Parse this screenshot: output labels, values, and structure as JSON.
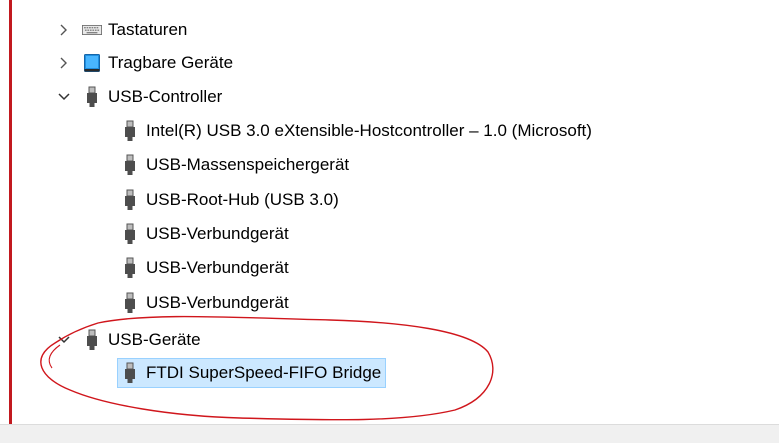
{
  "tree": {
    "tastaturen": {
      "label": "Tastaturen",
      "state": "collapsed"
    },
    "tragbare": {
      "label": "Tragbare Geräte",
      "state": "collapsed"
    },
    "usb_controller": {
      "label": "USB-Controller",
      "state": "expanded",
      "children": [
        "Intel(R) USB 3.0 eXtensible-Hostcontroller – 1.0 (Microsoft)",
        "USB-Massenspeichergerät",
        "USB-Root-Hub (USB 3.0)",
        "USB-Verbundgerät",
        "USB-Verbundgerät",
        "USB-Verbundgerät"
      ]
    },
    "usb_geraete": {
      "label": "USB-Geräte",
      "state": "expanded",
      "children": [
        "FTDI SuperSpeed-FIFO Bridge"
      ],
      "selected_child": "FTDI SuperSpeed-FIFO Bridge"
    }
  },
  "icons": {
    "keyboard": "keyboard-icon",
    "portable": "portable-device-icon",
    "usb": "usb-plug-icon",
    "expand": "chevron-right-icon",
    "collapse": "chevron-down-icon"
  },
  "colors": {
    "annotation": "#d0161c",
    "selection_bg": "#cce8ff",
    "selection_border": "#99d1ff"
  }
}
